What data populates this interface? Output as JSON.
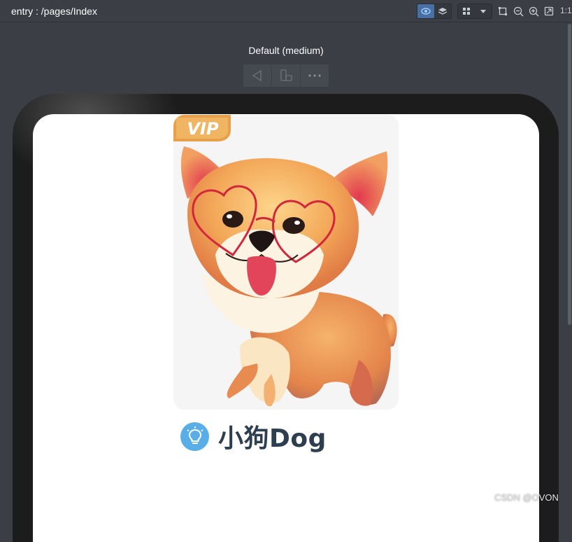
{
  "toolbar": {
    "page_path": "entry : /pages/Index",
    "ratio_label": "1:1"
  },
  "device": {
    "name": "Default (medium)"
  },
  "content": {
    "badge": "VIP",
    "caption": "小狗Dog"
  },
  "watermark": "CSDN @OVON",
  "colors": {
    "toolbar_bg": "#3b3e45",
    "frame": "#1c1c1c",
    "bulb": "#5aaee7",
    "caption_text": "#2c3e50",
    "vip_badge": "#e8a04a"
  },
  "icons": [
    "eye-icon",
    "layers-icon",
    "grid-icon",
    "chevron-down-icon",
    "crop-icon",
    "zoom-out-icon",
    "zoom-in-icon",
    "fit-icon",
    "back-icon",
    "rotate-icon",
    "more-icon",
    "lightbulb-icon"
  ]
}
